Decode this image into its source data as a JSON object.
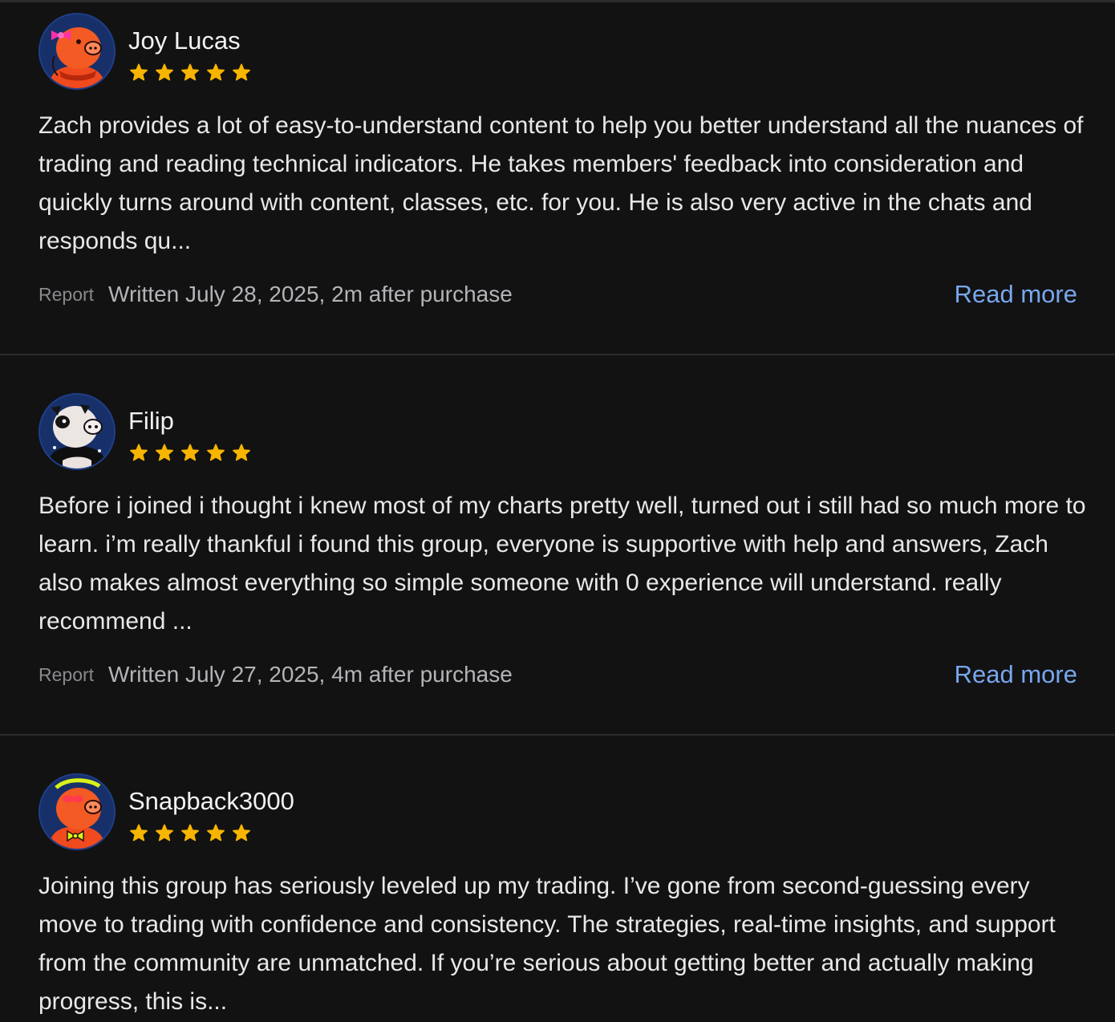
{
  "colors": {
    "background": "#121213",
    "divider": "#2c2c2e",
    "star": "#f7b500",
    "link": "#79a7ee",
    "avatar_bg": "#17306a"
  },
  "reviews": [
    {
      "name": "Joy Lucas",
      "rating": 5,
      "avatar_icon": "pig-with-pink-bow-avatar",
      "text": "Zach provides a lot of easy-to-understand content to help you better understand all the nuances of trading and reading technical indicators. He takes members' feedback into consideration and quickly turns around with content, classes, etc. for you. He is also very active in the chats and responds qu...",
      "report_label": "Report",
      "written": "Written July 28, 2025, 2m after purchase",
      "read_more": "Read more"
    },
    {
      "name": "Filip",
      "rating": 5,
      "avatar_icon": "panda-pig-avatar",
      "text": "Before i joined i thought i knew most of my charts pretty well, turned out i still had so much more to learn. i’m really thankful i found this group, everyone is supportive with help and answers, Zach also makes almost everything so simple someone with 0 experience will understand. really recommend ...",
      "report_label": "Report",
      "written": "Written July 27, 2025, 4m after purchase",
      "read_more": "Read more"
    },
    {
      "name": "Snapback3000",
      "rating": 5,
      "avatar_icon": "pig-with-bowtie-avatar",
      "text": "Joining this group has seriously leveled up my trading. I’ve gone from second-guessing every move to trading with confidence and consistency. The strategies, real-time insights, and support from the community are unmatched. If you’re serious about getting better and actually making progress, this is..."
    }
  ]
}
